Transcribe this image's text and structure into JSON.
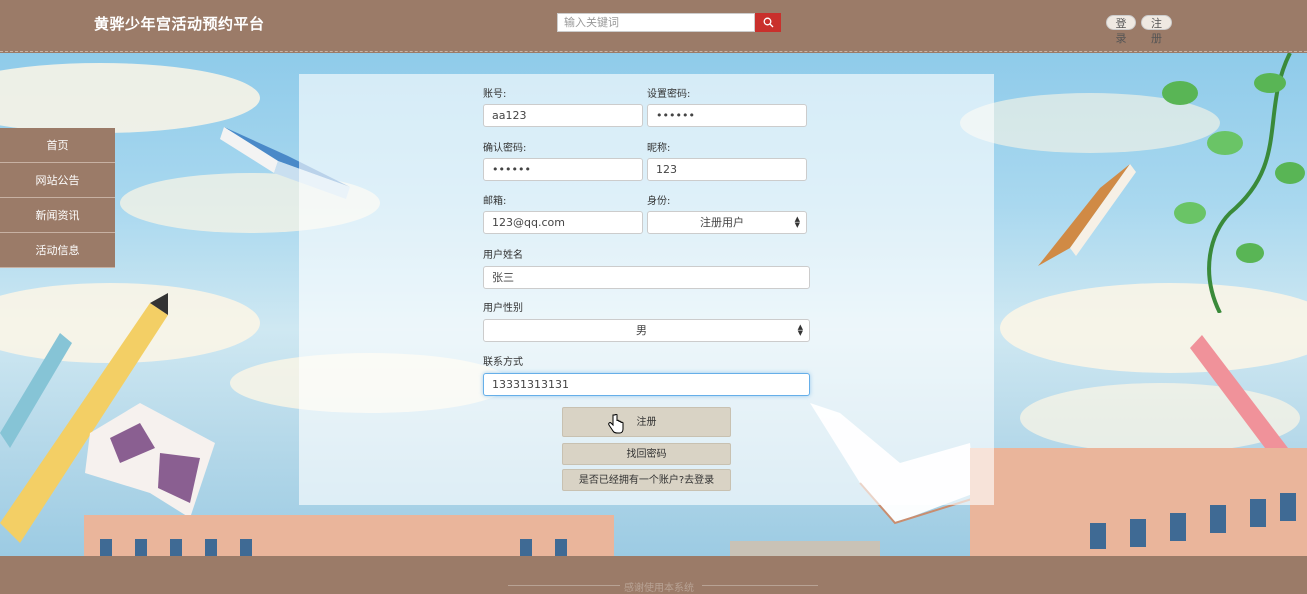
{
  "header": {
    "site_title": "黄骅少年宫活动预约平台",
    "search_placeholder": "输入关键词",
    "login_label": "登录",
    "register_label": "注册"
  },
  "sidenav": {
    "items": [
      {
        "label": "首页"
      },
      {
        "label": "网站公告"
      },
      {
        "label": "新闻资讯"
      },
      {
        "label": "活动信息"
      }
    ]
  },
  "form": {
    "account_label": "账号:",
    "account_value": "aa123",
    "password_label": "设置密码:",
    "password_value": "••••••",
    "confirm_label": "确认密码:",
    "confirm_value": "••••••",
    "nickname_label": "昵称:",
    "nickname_value": "123",
    "email_label": "邮箱:",
    "email_value": "123@qq.com",
    "role_label": "身份:",
    "role_value": "注册用户",
    "name_label": "用户姓名",
    "name_value": "张三",
    "gender_label": "用户性别",
    "gender_value": "男",
    "contact_label": "联系方式",
    "contact_value": "13331313131",
    "register_button": "注册",
    "recover_button": "找回密码",
    "goto_login_button": "是否已经拥有一个账户?去登录"
  },
  "footer": {
    "text": "感谢使用本系统"
  },
  "colors": {
    "header_bg": "#9b7b68",
    "search_button": "#c9302c",
    "button_bg": "#d9d3c5"
  }
}
